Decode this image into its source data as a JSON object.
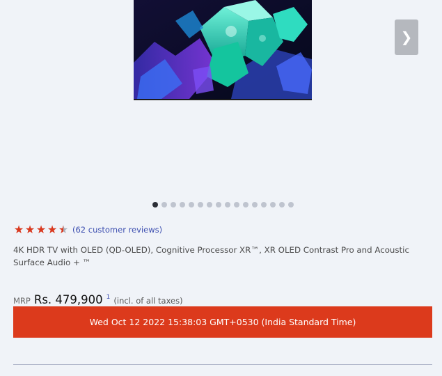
{
  "product_image": {
    "name": "tv-product-image"
  },
  "carousel": {
    "next_label": "❯",
    "total_dots": 16,
    "active_index": 0
  },
  "rating": {
    "value": 4.5,
    "max": 5,
    "reviews_text": "(62 customer reviews)"
  },
  "description": "4K HDR TV with OLED (QD-OLED), Cognitive Processor XR™, XR OLED Contrast Pro and Acoustic Surface Audio + ™",
  "price": {
    "mrp_label": "MRP",
    "amount": "Rs. 479,900",
    "footnote": "1",
    "taxes_note": "(incl. of all taxes)"
  },
  "datetime_banner": "Wed Oct 12 2022 15:38:03 GMT+0530 (India Standard Time)",
  "colors": {
    "accent_red": "#dc3a1c",
    "link_blue": "#3d4fb0",
    "star_red": "#d9381e",
    "background": "#f0f3f8"
  }
}
